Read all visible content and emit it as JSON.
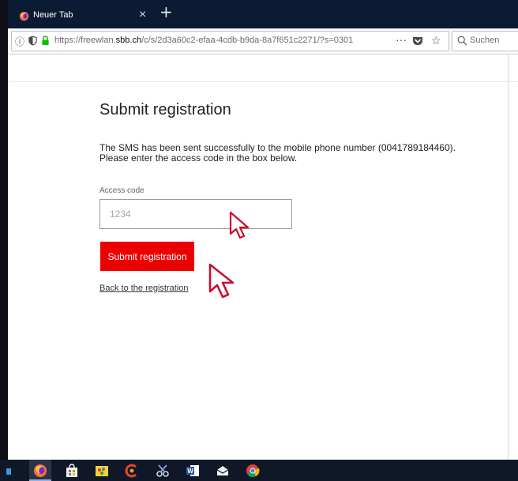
{
  "browser": {
    "tab": {
      "title": "Neuer Tab",
      "close_glyph": "×",
      "icon": "firefox-icon"
    },
    "new_tab_glyph": "+",
    "url": {
      "prefix": "https://freewlan.",
      "domain": "sbb.ch",
      "suffix": "/c/s/2d3a60c2-efaa-4cdb-b9da-8a7f651c2271/?s=0301",
      "info_glyph": "ⓘ",
      "more_glyph": "···",
      "star_glyph": "☆"
    },
    "search": {
      "placeholder": "Suchen"
    }
  },
  "page": {
    "title": "Submit registration",
    "message_line1": "The SMS has been sent successfully to the mobile phone number (0041789184460).",
    "message_line2": "Please enter the access code in the box below.",
    "access_code_label": "Access code",
    "access_code_placeholder": "1234",
    "access_code_value": "",
    "submit_label": "Submit registration",
    "back_link": "Back to the registration"
  },
  "colors": {
    "brand_red": "#eb0000",
    "tab_bar": "#0b1b33",
    "taskbar": "#101828",
    "cursor_outline": "#c8102e"
  },
  "taskbar": {
    "items": [
      "file-explorer-edge-icon",
      "firefox-icon",
      "store-icon",
      "paint-icon",
      "ccleaner-icon",
      "snipping-icon",
      "word-icon",
      "mail-icon",
      "chrome-icon"
    ]
  }
}
